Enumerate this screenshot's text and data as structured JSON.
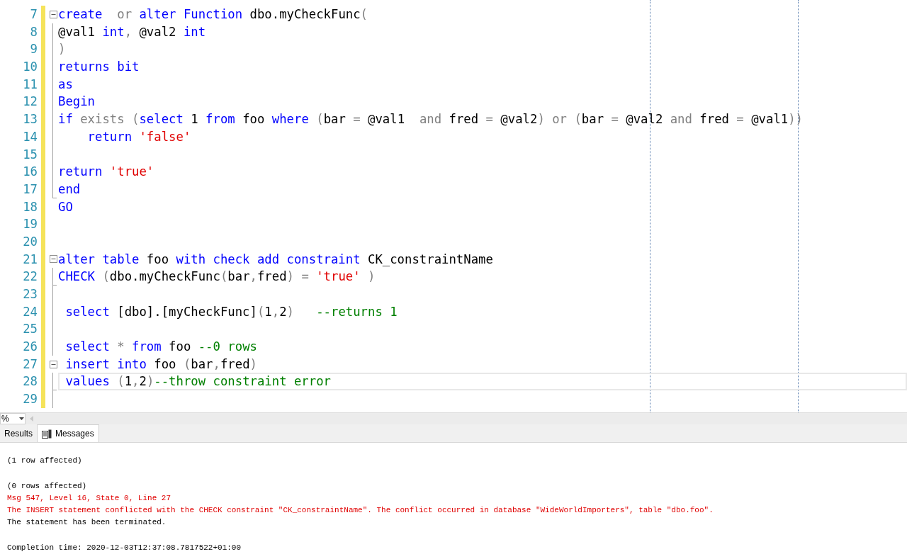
{
  "editor": {
    "lines": [
      {
        "number": "7",
        "kind": "start",
        "tokens": [
          {
            "kw": "create"
          },
          {
            "op": "  or"
          },
          {
            "kw": " alter"
          },
          {
            "kw": " Function"
          },
          {
            "plain": " dbo.myCheckFunc"
          },
          {
            "op": "("
          }
        ]
      },
      {
        "number": "8",
        "kind": "inside",
        "tokens": [
          {
            "plain": "@val1"
          },
          {
            "kw": " int"
          },
          {
            "op": ","
          },
          {
            "plain": " @val2"
          },
          {
            "kw": " int"
          }
        ]
      },
      {
        "number": "9",
        "kind": "inside",
        "tokens": [
          {
            "op": ")"
          }
        ]
      },
      {
        "number": "10",
        "kind": "inside",
        "tokens": [
          {
            "kw": "returns bit"
          }
        ]
      },
      {
        "number": "11",
        "kind": "inside",
        "tokens": [
          {
            "kw": "as"
          }
        ]
      },
      {
        "number": "12",
        "kind": "inside",
        "tokens": [
          {
            "kw": "Begin"
          }
        ]
      },
      {
        "number": "13",
        "kind": "inside",
        "tokens": [
          {
            "kw": "if"
          },
          {
            "op": " exists"
          },
          {
            "op": " ("
          },
          {
            "kw": "select"
          },
          {
            "plain": " 1"
          },
          {
            "kw": " from"
          },
          {
            "plain": " foo"
          },
          {
            "kw": " where"
          },
          {
            "op": " ("
          },
          {
            "plain": "bar"
          },
          {
            "op": " ="
          },
          {
            "plain": " @val1"
          },
          {
            "op": "  and"
          },
          {
            "plain": " fred"
          },
          {
            "op": " ="
          },
          {
            "plain": " @val2"
          },
          {
            "op": ")"
          },
          {
            "op": " or"
          },
          {
            "op": " ("
          },
          {
            "plain": "bar"
          },
          {
            "op": " ="
          },
          {
            "plain": " @val2"
          },
          {
            "op": " and"
          },
          {
            "plain": " fred"
          },
          {
            "op": " ="
          },
          {
            "plain": " @val1"
          },
          {
            "op": "))"
          }
        ]
      },
      {
        "number": "14",
        "kind": "inside",
        "tokens": [
          {
            "kw": "    return"
          },
          {
            "str": " 'false'"
          }
        ]
      },
      {
        "number": "15",
        "kind": "inside"
      },
      {
        "number": "16",
        "kind": "inside",
        "tokens": [
          {
            "kw": "return"
          },
          {
            "str": " 'true'"
          }
        ]
      },
      {
        "number": "17",
        "kind": "end",
        "tokens": [
          {
            "kw": "end"
          }
        ]
      },
      {
        "number": "18",
        "kind": "plain",
        "tokens": [
          {
            "kw": "GO"
          }
        ]
      },
      {
        "number": "19",
        "kind": "plain"
      },
      {
        "number": "20",
        "kind": "plain"
      },
      {
        "number": "21",
        "kind": "start",
        "tokens": [
          {
            "kw": "alter table"
          },
          {
            "plain": " foo"
          },
          {
            "kw": " with check add constraint"
          },
          {
            "plain": " CK_constraintName"
          }
        ]
      },
      {
        "number": "22",
        "kind": "end",
        "tokens": [
          {
            "kw": "CHECK"
          },
          {
            "op": " ("
          },
          {
            "plain": "dbo.myCheckFunc"
          },
          {
            "op": "("
          },
          {
            "plain": "bar"
          },
          {
            "op": ","
          },
          {
            "plain": "fred"
          },
          {
            "op": ")"
          },
          {
            "op": " ="
          },
          {
            "str": " 'true'"
          },
          {
            "op": " )"
          }
        ]
      },
      {
        "number": "23",
        "kind": "inside"
      },
      {
        "number": "24",
        "kind": "inside",
        "tokens": [
          {
            "kw": " select"
          },
          {
            "plain": " [dbo].[myCheckFunc]"
          },
          {
            "op": "("
          },
          {
            "plain": "1"
          },
          {
            "op": ","
          },
          {
            "plain": "2"
          },
          {
            "op": ")"
          },
          {
            "cmt": "   --returns 1"
          }
        ]
      },
      {
        "number": "25",
        "kind": "inside"
      },
      {
        "number": "26",
        "kind": "inside",
        "tokens": [
          {
            "kw": " select"
          },
          {
            "op": " *"
          },
          {
            "kw": " from"
          },
          {
            "plain": " foo"
          },
          {
            "cmt": " --0 rows"
          }
        ]
      },
      {
        "number": "27",
        "kind": "start",
        "tokens": [
          {
            "kw": " insert into"
          },
          {
            "plain": " foo"
          },
          {
            "op": " ("
          },
          {
            "plain": "bar"
          },
          {
            "op": ","
          },
          {
            "plain": "fred"
          },
          {
            "op": ")"
          }
        ]
      },
      {
        "number": "28",
        "kind": "end",
        "current": true,
        "tokens": [
          {
            "kw": " values"
          },
          {
            "op": " ("
          },
          {
            "plain": "1"
          },
          {
            "op": ","
          },
          {
            "plain": "2"
          },
          {
            "op": ")"
          },
          {
            "cmt": "--throw constraint error"
          }
        ]
      },
      {
        "number": "29",
        "kind": "inside"
      }
    ]
  },
  "zoom": {
    "value": "%"
  },
  "tabs": [
    {
      "label": "Results",
      "selected": false,
      "icon": false
    },
    {
      "label": "Messages",
      "selected": true,
      "icon": true
    }
  ],
  "message_groups": [
    [
      {
        "error": false,
        "text": "(1 row affected)"
      }
    ],
    [
      {
        "error": false,
        "text": "(0 rows affected)"
      },
      {
        "error": true,
        "text": "Msg 547, Level 16, State 0, Line 27"
      },
      {
        "error": true,
        "text": "The INSERT statement conflicted with the CHECK constraint \"CK_constraintName\". The conflict occurred in database \"WideWorldImporters\", table \"dbo.foo\"."
      },
      {
        "error": false,
        "text": "The statement has been terminated."
      }
    ],
    [
      {
        "error": false,
        "text": "Completion time: 2020-12-03T12:37:08.7817522+01:00"
      }
    ]
  ]
}
